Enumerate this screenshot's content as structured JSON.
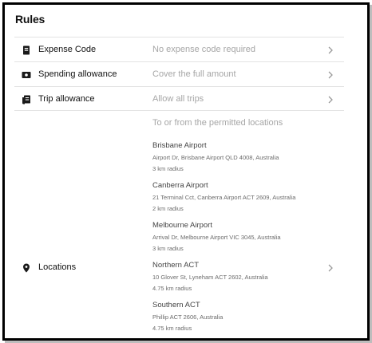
{
  "header": {
    "title": "Rules"
  },
  "rules": [
    {
      "label": "Expense Code",
      "value": "No expense code required",
      "icon": "document-icon"
    },
    {
      "label": "Spending allowance",
      "value": "Cover the full amount",
      "icon": "wallet-icon"
    },
    {
      "label": "Trip allowance",
      "value": "Allow all trips",
      "icon": "receipt-icon"
    }
  ],
  "locations": {
    "label": "Locations",
    "icon": "map-pin-icon",
    "lead": "To or from the permitted locations",
    "places": [
      {
        "name": "Brisbane Airport",
        "address": "Airport Dr, Brisbane Airport QLD 4008, Australia",
        "radius": "3 km radius"
      },
      {
        "name": "Canberra Airport",
        "address": "21 Terminal Cct, Canberra Airport ACT 2609, Australia",
        "radius": "2 km radius"
      },
      {
        "name": "Melbourne Airport",
        "address": "Arrival Dr, Melbourne Airport VIC 3045, Australia",
        "radius": "3 km radius"
      },
      {
        "name": "Northern ACT",
        "address": "10 Glover St, Lyneham ACT 2602, Australia",
        "radius": "4.75 km radius"
      },
      {
        "name": "Southern ACT",
        "address": "Phillip ACT 2606, Australia",
        "radius": "4.75 km radius"
      }
    ]
  },
  "colors": {
    "text": "#111111",
    "muted": "#a6a6a6",
    "divider": "#e3e3e3",
    "frame": "#000000"
  }
}
